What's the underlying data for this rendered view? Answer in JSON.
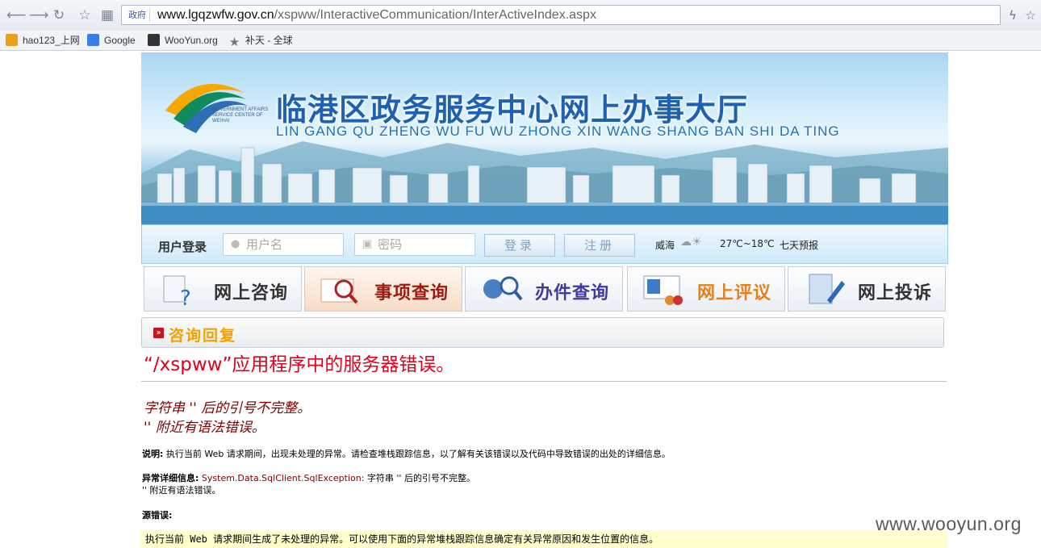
{
  "browser": {
    "address_tag": "政府",
    "url_domain": "www.lgqzwfw.gov.cn",
    "url_path": "/xspww/InteractiveCommunication/InterActiveIndex.aspx",
    "bookmarks": [
      {
        "label": "hao123_上网",
        "icon": "hao123-icon",
        "color": "#e8a21a"
      },
      {
        "label": "Google",
        "icon": "google-icon",
        "color": "#3b7ce6"
      },
      {
        "label": "WooYun.org",
        "icon": "wooyun-icon",
        "color": "#333333"
      },
      {
        "label": "补天 - 全球",
        "icon": "star-icon",
        "color": "#777777"
      }
    ]
  },
  "site": {
    "title": "临港区政务服务中心网上办事大厅",
    "pinyin": "LIN GANG QU ZHENG WU FU WU ZHONG XIN WANG SHANG BAN SHI DA TING",
    "logo_text": "GOVERNMENT AFFAIRS SERVICE CENTER OF WEIHAI",
    "login": {
      "label": "用户登录",
      "username_placeholder": "用户名",
      "password_placeholder": "密码",
      "login_button": "登录",
      "register_button": "注册"
    },
    "weather": {
      "city": "威海",
      "temp": "27℃~18℃",
      "forecast_link": "七天预报"
    },
    "nav": [
      {
        "label": "网上咨询",
        "icon": "consult-icon",
        "color": "#333333"
      },
      {
        "label": "事项查询",
        "icon": "search-item-icon",
        "color": "#9b1a12"
      },
      {
        "label": "办件查询",
        "icon": "case-query-icon",
        "color": "#3f3aa0"
      },
      {
        "label": "网上评议",
        "icon": "review-icon",
        "color": "#e8801a"
      },
      {
        "label": "网上投诉",
        "icon": "complaint-icon",
        "color": "#333333"
      }
    ],
    "section_title": "咨询回复"
  },
  "error": {
    "title": "“/xspww”应用程序中的服务器错误。",
    "message_line1": "字符串 '' 后的引号不完整。",
    "message_line2": "'' 附近有语法错误。",
    "desc_label": "说明:",
    "desc_text": " 执行当前 Web 请求期间，出现未处理的异常。请检查堆栈跟踪信息，以了解有关该错误以及代码中导致错误的出处的详细信息。",
    "exception_label": "异常详细信息:",
    "exception_type": " System.Data.SqlClient.SqlException:",
    "exception_text": " 字符串 '' 后的引号不完整。",
    "exception_text2": "'' 附近有语法错误。",
    "source_label": "源错误:",
    "code_text": "执行当前 Web 请求期间生成了未处理的异常。可以使用下面的异常堆栈跟踪信息确定有关异常原因和发生位置的信息。"
  },
  "watermark": "www.wooyun.org"
}
